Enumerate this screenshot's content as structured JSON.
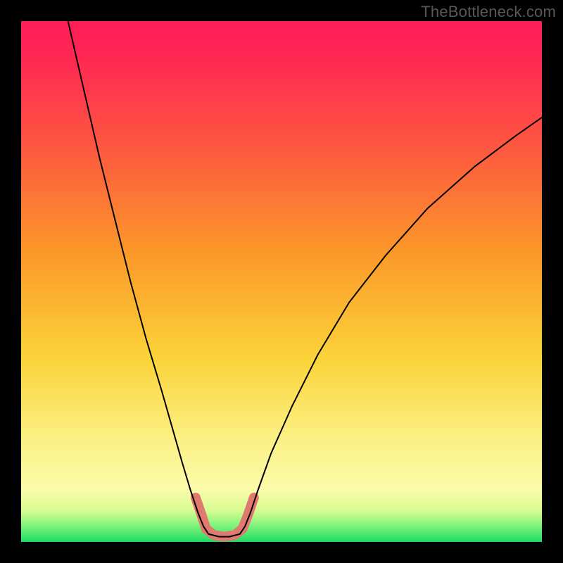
{
  "watermark": "TheBottleneck.com",
  "chart_data": {
    "type": "line",
    "title": "",
    "xlabel": "",
    "ylabel": "",
    "xlim": [
      0,
      100
    ],
    "ylim": [
      0,
      100
    ],
    "grid": false,
    "background_gradient": {
      "stops": [
        {
          "offset": 0.0,
          "color": "#1fdc64"
        },
        {
          "offset": 0.03,
          "color": "#7cf37c"
        },
        {
          "offset": 0.06,
          "color": "#d6fc91"
        },
        {
          "offset": 0.1,
          "color": "#fbfbaa"
        },
        {
          "offset": 0.2,
          "color": "#fbf083"
        },
        {
          "offset": 0.35,
          "color": "#fbd43a"
        },
        {
          "offset": 0.55,
          "color": "#fb9a29"
        },
        {
          "offset": 0.75,
          "color": "#fd5a3f"
        },
        {
          "offset": 0.92,
          "color": "#ff2a52"
        },
        {
          "offset": 1.0,
          "color": "#ff1c57"
        }
      ]
    },
    "series": [
      {
        "name": "curve",
        "type": "line",
        "color": "#000000",
        "stroke_width": 2,
        "points": [
          {
            "x": 9.0,
            "y": 100.0
          },
          {
            "x": 12.0,
            "y": 87.0
          },
          {
            "x": 15.0,
            "y": 74.0
          },
          {
            "x": 18.0,
            "y": 62.0
          },
          {
            "x": 21.0,
            "y": 50.0
          },
          {
            "x": 24.0,
            "y": 39.0
          },
          {
            "x": 27.0,
            "y": 29.0
          },
          {
            "x": 29.0,
            "y": 22.0
          },
          {
            "x": 31.0,
            "y": 15.0
          },
          {
            "x": 32.5,
            "y": 10.0
          },
          {
            "x": 34.0,
            "y": 5.5
          },
          {
            "x": 35.0,
            "y": 3.0
          },
          {
            "x": 36.0,
            "y": 1.5
          },
          {
            "x": 38.0,
            "y": 1.0
          },
          {
            "x": 40.0,
            "y": 1.0
          },
          {
            "x": 42.0,
            "y": 1.5
          },
          {
            "x": 43.0,
            "y": 3.0
          },
          {
            "x": 44.0,
            "y": 5.5
          },
          {
            "x": 45.5,
            "y": 10.0
          },
          {
            "x": 48.0,
            "y": 17.0
          },
          {
            "x": 52.0,
            "y": 26.0
          },
          {
            "x": 57.0,
            "y": 36.0
          },
          {
            "x": 63.0,
            "y": 46.0
          },
          {
            "x": 70.0,
            "y": 55.0
          },
          {
            "x": 78.0,
            "y": 64.0
          },
          {
            "x": 87.0,
            "y": 72.0
          },
          {
            "x": 95.0,
            "y": 78.0
          },
          {
            "x": 100.0,
            "y": 81.5
          }
        ]
      },
      {
        "name": "highlight-band",
        "type": "line",
        "color": "#e0796f",
        "stroke_width": 14,
        "linecap": "round",
        "points": [
          {
            "x": 33.5,
            "y": 8.5
          },
          {
            "x": 34.7,
            "y": 5.0
          },
          {
            "x": 35.5,
            "y": 2.5
          },
          {
            "x": 37.0,
            "y": 1.3
          },
          {
            "x": 39.0,
            "y": 1.0
          },
          {
            "x": 41.0,
            "y": 1.3
          },
          {
            "x": 42.5,
            "y": 2.5
          },
          {
            "x": 43.5,
            "y": 5.0
          },
          {
            "x": 44.7,
            "y": 8.5
          }
        ]
      }
    ]
  }
}
